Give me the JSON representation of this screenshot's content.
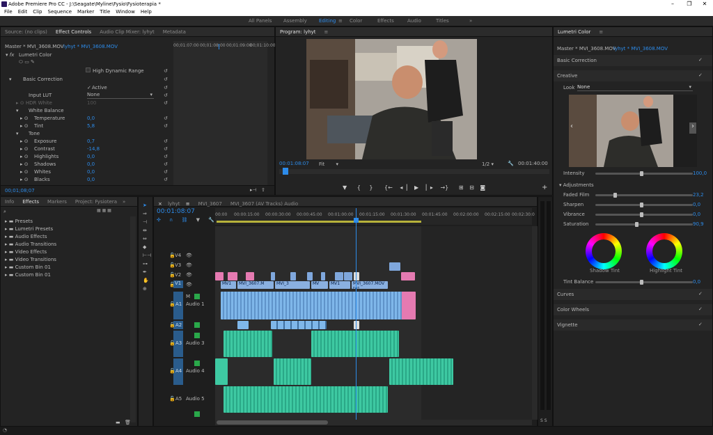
{
  "window": {
    "title": "Adobe Premiere Pro CC - J:\\Seagate\\Myline\\Fysio\\Fysioterapia *"
  },
  "menu": [
    "File",
    "Edit",
    "Clip",
    "Sequence",
    "Marker",
    "Title",
    "Window",
    "Help"
  ],
  "workspaces": [
    "All Panels",
    "Assembly",
    "Editing",
    "Color",
    "Effects",
    "Audio",
    "Titles"
  ],
  "workspace_active": "Editing",
  "effect_controls": {
    "tabs": [
      "Source: (no clips)",
      "Effect Controls",
      "Audio Clip Mixer: lyhyt",
      "Metadata"
    ],
    "master": "Master * MVI_3608.MOV",
    "clip": "lyhyt * MVI_3608.MOV",
    "ruler": [
      "00;01:07:00",
      "00;01:08:00",
      "00;01:09:00",
      "00;01:10:00"
    ],
    "effect": "Lumetri Color",
    "hdr": "High Dynamic Range",
    "basic_correction": "Basic Correction",
    "active": "Active",
    "input_lut": "Input LUT",
    "input_lut_value": "None",
    "hdr_white": "HDR White",
    "hdr_white_value": "100",
    "white_balance": "White Balance",
    "temperature": "Temperature",
    "temperature_value": "0,0",
    "tint": "Tint",
    "tint_value": "5,8",
    "tone": "Tone",
    "exposure": "Exposure",
    "exposure_value": "0,7",
    "contrast": "Contrast",
    "contrast_value": "-14,8",
    "highlights": "Highlights",
    "highlights_value": "0,0",
    "shadows": "Shadows",
    "shadows_value": "0,0",
    "whites": "Whites",
    "whites_value": "0,0",
    "blacks": "Blacks",
    "blacks_value": "0,0",
    "timecode": "00;01;08;07"
  },
  "program": {
    "title": "Program: lyhyt",
    "timecode": "00:01:08:07",
    "fit": "Fit",
    "fraction": "1/2",
    "duration": "00:01:40:00"
  },
  "lumetri": {
    "title": "Lumetri Color",
    "master": "Master * MVI_3608.MOV",
    "clip": "lyhyt * MVI_3608.MOV",
    "basic": "Basic Correction",
    "creative": "Creative",
    "look": "Look",
    "look_value": "None",
    "intensity": "Intensity",
    "intensity_value": "100,0",
    "adjustments": "Adjustments",
    "faded": "Faded Film",
    "faded_value": "23,2",
    "sharpen": "Sharpen",
    "sharpen_value": "0,0",
    "vibrance": "Vibrance",
    "vibrance_value": "0,0",
    "saturation": "Saturation",
    "saturation_value": "90,9",
    "shadow_tint": "Shadow Tint",
    "highlight_tint": "Highlight Tint",
    "tint_balance": "Tint Balance",
    "tint_balance_value": "0,0",
    "curves": "Curves",
    "color_wheels": "Color Wheels",
    "vignette": "Vignette"
  },
  "effects_panel": {
    "tabs": [
      "Info",
      "Effects",
      "Markers",
      "Project: Fysiotera"
    ],
    "items": [
      "Presets",
      "Lumetri Presets",
      "Audio Effects",
      "Audio Transitions",
      "Video Effects",
      "Video Transitions",
      "Custom Bin 01",
      "Custom Bin 01"
    ]
  },
  "timeline": {
    "tabs": [
      "lyhyt",
      "MVI_3607",
      "MVI_3607 (AV Tracks) Audio"
    ],
    "timecode": "00:01:08:07",
    "ruler": [
      "00:00",
      "00:00:15:00",
      "00:00:30:00",
      "00:00:45:00",
      "00:01:00:00",
      "00:01:15:00",
      "00:01:30:00",
      "00:01:45:00",
      "00:02:00:00",
      "00:02:15:00",
      "00:02:30:0"
    ],
    "video_tracks": [
      "V4",
      "V3",
      "V2",
      "V1"
    ],
    "audio_tracks": [
      {
        "id": "A1",
        "name": "Audio 1"
      },
      {
        "id": "A2",
        "name": ""
      },
      {
        "id": "A3",
        "name": "Audio 3"
      },
      {
        "id": "A4",
        "name": "Audio 4"
      },
      {
        "id": "A5",
        "name": "Audio 5"
      }
    ],
    "v1_clips": [
      "MV1",
      "MVI_3607.M",
      "MVI_3",
      "MV",
      "MV1",
      "MVI_3607.MOV [V]"
    ]
  },
  "colors": {
    "accent": "#2d8ceb",
    "video": "#8ab0e0",
    "pink": "#e57ab1",
    "audio": "#7fb7ea",
    "green": "#3ec9a2"
  }
}
